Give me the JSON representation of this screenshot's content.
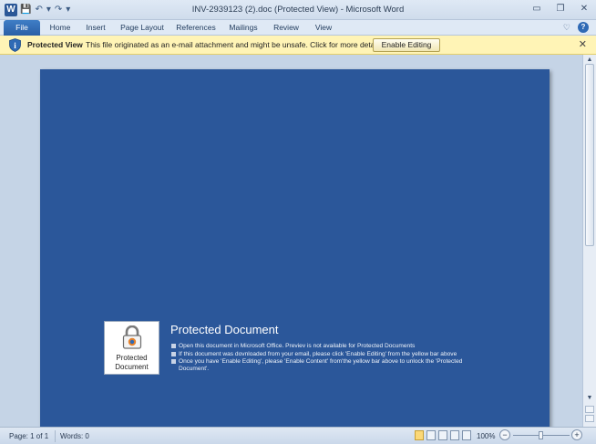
{
  "window": {
    "title": "INV-2939123 (2).doc (Protected View)  -  Microsoft Word",
    "logo_letter": "W",
    "qat": [
      "💾",
      "↶",
      "▾",
      "↷",
      "▾"
    ]
  },
  "ribbon": {
    "tabs": [
      "File",
      "Home",
      "Insert",
      "Page Layout",
      "References",
      "Mailings",
      "Review",
      "View"
    ]
  },
  "infobar": {
    "label": "Protected View",
    "message": "This file originated as an e-mail attachment and might be unsafe. Click for more details.",
    "button": "Enable Editing",
    "bg_color": "#fff4b6"
  },
  "document": {
    "page_color": "#2b579a",
    "lock_caption": "Protected Document",
    "heading": "Protected Document",
    "bullets": [
      "Open this document in Microsoft Office. Previev is not available for Protected Documents",
      "If this document was dovnloaded from your email, please click 'Enable Editing' from the yellow bar above",
      "Once you have 'Enable Editing', please 'Enable Content' from'the yellow bar above to unlock the 'Protected Document'."
    ]
  },
  "status": {
    "page": "Page: 1 of 1",
    "words": "Words: 0",
    "zoom": "100%",
    "zoom_value": 100
  }
}
